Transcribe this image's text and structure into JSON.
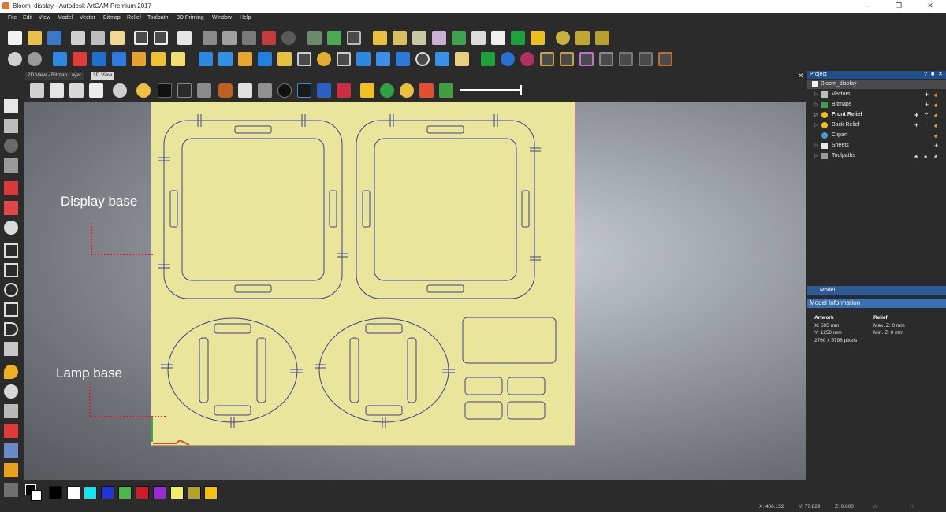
{
  "window": {
    "title": "Bloom_display - Autodesk ArtCAM Premium 2017",
    "controls": [
      "–",
      "❐",
      "✕"
    ]
  },
  "menu": [
    "File",
    "Edit",
    "View",
    "Model",
    "Vector",
    "Bitmap",
    "Relief",
    "Toolpath",
    "3D Printing",
    "Window",
    "Help"
  ],
  "view_tabs": {
    "tabs": [
      {
        "label": "2D View - Bitmap Layer",
        "active": false
      },
      {
        "label": "3D View",
        "active": true
      }
    ],
    "close": "✕"
  },
  "callouts": {
    "display_base": "Display base",
    "lamp_base": "Lamp base"
  },
  "project": {
    "title": "Project",
    "header_controls": [
      "?",
      "■",
      "✕"
    ],
    "root": "Bloom_display",
    "items": [
      {
        "label": "Vectors",
        "icon": "vectors-icon",
        "bold": false
      },
      {
        "label": "Bitmaps",
        "icon": "bitmaps-icon",
        "bold": false
      },
      {
        "label": "Front Relief",
        "icon": "star-icon",
        "bold": true
      },
      {
        "label": "Back Relief",
        "icon": "star-icon",
        "bold": false
      },
      {
        "label": "Clipart",
        "icon": "star-icon",
        "bold": false
      },
      {
        "label": "Sheets",
        "icon": "sheets-icon",
        "bold": false
      },
      {
        "label": "Toolpaths",
        "icon": "toolpaths-icon",
        "bold": false
      }
    ]
  },
  "model": {
    "tab": "Model",
    "info_title": "Model Information",
    "artwork": {
      "heading": "Artwork",
      "x": "X: 595 mm",
      "y": "Y: 1250 mm",
      "pixels": "2760 x 5798 pixels"
    },
    "relief": {
      "heading": "Relief",
      "max_z": "Max. Z: 0 mm",
      "min_z": "Min. Z: 0 mm"
    }
  },
  "palette": {
    "colors": [
      "#000000",
      "#ffffff",
      "#12e6ee",
      "#2235d6",
      "#4cb84c",
      "#d21b2a",
      "#9a2ad8",
      "#f2ee6a",
      "#b5a42a",
      "#f4c010"
    ]
  },
  "status": {
    "x": "X: 406.152",
    "y": "Y: 77.829",
    "z": "Z: 0.000",
    "w": "W:",
    "h": "H:"
  }
}
